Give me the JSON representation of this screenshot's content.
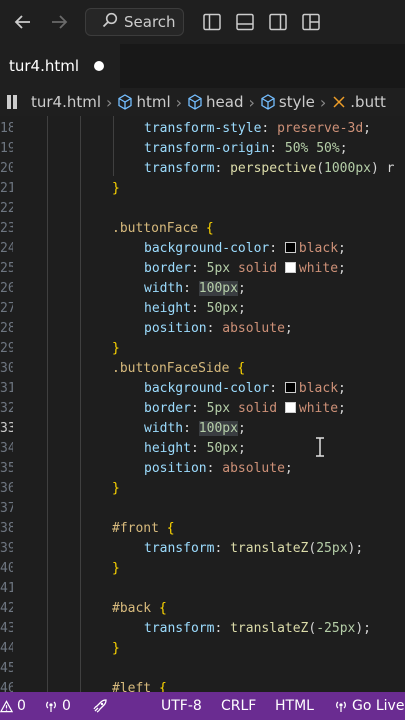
{
  "titlebar": {
    "search_label": "Search",
    "icons": [
      "back-arrow-icon",
      "forward-arrow-icon",
      "search-icon",
      "toggle-primary-sidebar-icon",
      "toggle-panel-icon",
      "toggle-secondary-sidebar-icon",
      "customize-layout-icon"
    ]
  },
  "tab": {
    "filename": "tur4.html",
    "modified": true
  },
  "breadcrumb": {
    "items": [
      "tur4.html",
      "html",
      "head",
      "style",
      ".butt"
    ]
  },
  "editor": {
    "active_line": "33",
    "lines": [
      {
        "n": "18",
        "tokens": [
          [
            "prop",
            "transform-style"
          ],
          [
            "punc",
            ": "
          ],
          [
            "val",
            "preserve-3d"
          ],
          [
            "punc",
            ";"
          ]
        ]
      },
      {
        "n": "19",
        "tokens": [
          [
            "prop",
            "transform-origin"
          ],
          [
            "punc",
            ": "
          ],
          [
            "num",
            "50%"
          ],
          [
            "punc",
            " "
          ],
          [
            "num",
            "50%"
          ],
          [
            "punc",
            ";"
          ]
        ]
      },
      {
        "n": "20",
        "tokens": [
          [
            "prop",
            "transform"
          ],
          [
            "punc",
            ": "
          ],
          [
            "fn",
            "perspective"
          ],
          [
            "punc",
            "("
          ],
          [
            "num",
            "1000px"
          ],
          [
            "punc",
            ") r"
          ]
        ]
      },
      {
        "n": "21",
        "tokens": [
          [
            "brace",
            "}"
          ]
        ]
      },
      {
        "n": "22",
        "tokens": []
      },
      {
        "n": "23",
        "tokens": [
          [
            "sel",
            ".buttonFace"
          ],
          [
            "punc",
            " "
          ],
          [
            "brace",
            "{"
          ]
        ]
      },
      {
        "n": "24",
        "tokens": [
          [
            "prop",
            "background-color"
          ],
          [
            "punc",
            ": "
          ],
          [
            "swatch-black",
            ""
          ],
          [
            "val",
            "black"
          ],
          [
            "punc",
            ";"
          ]
        ]
      },
      {
        "n": "25",
        "tokens": [
          [
            "prop",
            "border"
          ],
          [
            "punc",
            ": "
          ],
          [
            "num",
            "5px"
          ],
          [
            "punc",
            " "
          ],
          [
            "val",
            "solid"
          ],
          [
            "punc",
            " "
          ],
          [
            "swatch-white",
            ""
          ],
          [
            "val",
            "white"
          ],
          [
            "punc",
            ";"
          ]
        ]
      },
      {
        "n": "26",
        "tokens": [
          [
            "prop",
            "width"
          ],
          [
            "punc",
            ": "
          ],
          [
            "numhl",
            "100px"
          ],
          [
            "punc",
            ";"
          ]
        ]
      },
      {
        "n": "27",
        "tokens": [
          [
            "prop",
            "height"
          ],
          [
            "punc",
            ": "
          ],
          [
            "num",
            "50px"
          ],
          [
            "punc",
            ";"
          ]
        ]
      },
      {
        "n": "28",
        "tokens": [
          [
            "prop",
            "position"
          ],
          [
            "punc",
            ": "
          ],
          [
            "val",
            "absolute"
          ],
          [
            "punc",
            ";"
          ]
        ]
      },
      {
        "n": "29",
        "tokens": [
          [
            "brace",
            "}"
          ]
        ]
      },
      {
        "n": "30",
        "tokens": [
          [
            "sel",
            ".buttonFaceSide"
          ],
          [
            "punc",
            " "
          ],
          [
            "brace",
            "{"
          ]
        ]
      },
      {
        "n": "31",
        "tokens": [
          [
            "prop",
            "background-color"
          ],
          [
            "punc",
            ": "
          ],
          [
            "swatch-black",
            ""
          ],
          [
            "val",
            "black"
          ],
          [
            "punc",
            ";"
          ]
        ]
      },
      {
        "n": "32",
        "tokens": [
          [
            "prop",
            "border"
          ],
          [
            "punc",
            ": "
          ],
          [
            "num",
            "5px"
          ],
          [
            "punc",
            " "
          ],
          [
            "val",
            "solid"
          ],
          [
            "punc",
            " "
          ],
          [
            "swatch-white",
            ""
          ],
          [
            "val",
            "white"
          ],
          [
            "punc",
            ";"
          ]
        ]
      },
      {
        "n": "33",
        "tokens": [
          [
            "prop",
            "width"
          ],
          [
            "punc",
            ": "
          ],
          [
            "numhl",
            "100px"
          ],
          [
            "punc",
            ";"
          ]
        ]
      },
      {
        "n": "34",
        "tokens": [
          [
            "prop",
            "height"
          ],
          [
            "punc",
            ": "
          ],
          [
            "num",
            "50px"
          ],
          [
            "punc",
            ";"
          ]
        ]
      },
      {
        "n": "35",
        "tokens": [
          [
            "prop",
            "position"
          ],
          [
            "punc",
            ": "
          ],
          [
            "val",
            "absolute"
          ],
          [
            "punc",
            ";"
          ]
        ]
      },
      {
        "n": "36",
        "tokens": [
          [
            "brace",
            "}"
          ]
        ]
      },
      {
        "n": "37",
        "tokens": []
      },
      {
        "n": "38",
        "tokens": [
          [
            "sel",
            "#front"
          ],
          [
            "punc",
            " "
          ],
          [
            "brace",
            "{"
          ]
        ]
      },
      {
        "n": "39",
        "tokens": [
          [
            "prop",
            "transform"
          ],
          [
            "punc",
            ": "
          ],
          [
            "fn",
            "translateZ"
          ],
          [
            "punc",
            "("
          ],
          [
            "num",
            "25px"
          ],
          [
            "punc",
            ");"
          ]
        ]
      },
      {
        "n": "40",
        "tokens": [
          [
            "brace",
            "}"
          ]
        ]
      },
      {
        "n": "41",
        "tokens": []
      },
      {
        "n": "42",
        "tokens": [
          [
            "sel",
            "#back"
          ],
          [
            "punc",
            " "
          ],
          [
            "brace",
            "{"
          ]
        ]
      },
      {
        "n": "43",
        "tokens": [
          [
            "prop",
            "transform"
          ],
          [
            "punc",
            ": "
          ],
          [
            "fn",
            "translateZ"
          ],
          [
            "punc",
            "("
          ],
          [
            "num",
            "-25px"
          ],
          [
            "punc",
            ");"
          ]
        ]
      },
      {
        "n": "44",
        "tokens": [
          [
            "brace",
            "}"
          ]
        ]
      },
      {
        "n": "45",
        "tokens": []
      },
      {
        "n": "46",
        "tokens": [
          [
            "sel",
            "#left"
          ],
          [
            "punc",
            " "
          ],
          [
            "brace",
            "{"
          ]
        ]
      }
    ]
  },
  "statusbar": {
    "warnings": "0",
    "ports": "0",
    "encoding": "UTF-8",
    "eol": "CRLF",
    "language": "HTML",
    "golive": "Go Live"
  },
  "colors": {
    "statusbar": "#6a2c91",
    "editor_bg": "#1e1e1e"
  }
}
